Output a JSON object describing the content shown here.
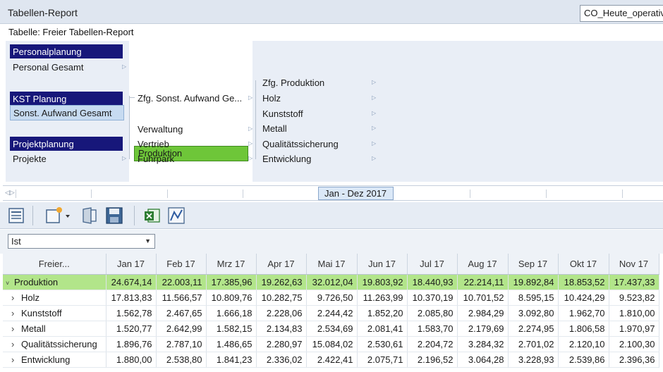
{
  "window": {
    "title": "Tabellen-Report",
    "profile_combo": "CO_Heute_operativ"
  },
  "subtitle": "Tabelle: Freier Tabellen-Report",
  "navigator": {
    "groups": [
      {
        "header": "Personalplanung",
        "item": "Personal Gesamt"
      },
      {
        "header": "KST Planung",
        "item": "Sonst. Aufwand Gesamt"
      },
      {
        "header": "Projektplanung",
        "item": "Projekte"
      }
    ],
    "column2": [
      "Zfg. Sonst. Aufwand Ge...",
      "Produktion",
      "Verwaltung",
      "Vertrieb",
      "Fuhrpark"
    ],
    "column3": [
      "Zfg. Produktion",
      "Holz",
      "Kunststoff",
      "Metall",
      "Qualitätssicherung",
      "Entwicklung"
    ]
  },
  "timeline": {
    "period": "Jan - Dez 2017"
  },
  "toolbar": {
    "icons": [
      "report-view-icon",
      "new-dropdown-icon",
      "open-icon",
      "save-icon",
      "excel-export-icon",
      "chart-icon"
    ]
  },
  "filter": {
    "selected": "Ist"
  },
  "table": {
    "columns": [
      "Freier...",
      "Jan 17",
      "Feb 17",
      "Mrz 17",
      "Apr 17",
      "Mai 17",
      "Jun 17",
      "Jul 17",
      "Aug 17",
      "Sep 17",
      "Okt 17",
      "Nov 17"
    ],
    "rows": [
      {
        "label": "Produktion",
        "expanded": true,
        "values": [
          "24.674,14",
          "22.003,11",
          "17.385,96",
          "19.262,63",
          "32.012,04",
          "19.803,92",
          "18.440,93",
          "22.214,11",
          "19.892,84",
          "18.853,52",
          "17.437,33"
        ]
      },
      {
        "label": "Holz",
        "values": [
          "17.813,83",
          "11.566,57",
          "10.809,76",
          "10.282,75",
          "9.726,50",
          "11.263,99",
          "10.370,19",
          "10.701,52",
          "8.595,15",
          "10.424,29",
          "9.523,82"
        ]
      },
      {
        "label": "Kunststoff",
        "values": [
          "1.562,78",
          "2.467,65",
          "1.666,18",
          "2.228,06",
          "2.244,42",
          "1.852,20",
          "2.085,80",
          "2.984,29",
          "3.092,80",
          "1.962,70",
          "1.810,00"
        ]
      },
      {
        "label": "Metall",
        "values": [
          "1.520,77",
          "2.642,99",
          "1.582,15",
          "2.134,83",
          "2.534,69",
          "2.081,41",
          "1.583,70",
          "2.179,69",
          "2.274,95",
          "1.806,58",
          "1.970,97"
        ]
      },
      {
        "label": "Qualitätssicherung",
        "values": [
          "1.896,76",
          "2.787,10",
          "1.486,65",
          "2.280,97",
          "15.084,02",
          "2.530,61",
          "2.204,72",
          "3.284,32",
          "2.701,02",
          "2.120,10",
          "2.100,30"
        ]
      },
      {
        "label": "Entwicklung",
        "values": [
          "1.880,00",
          "2.538,80",
          "1.841,23",
          "2.336,02",
          "2.422,41",
          "2.075,71",
          "2.196,52",
          "3.064,28",
          "3.228,93",
          "2.539,86",
          "2.396,36"
        ]
      }
    ]
  },
  "colors": {
    "group_header": "#17177a",
    "selected_green": "#6ec639",
    "total_row": "#b2e58a"
  }
}
